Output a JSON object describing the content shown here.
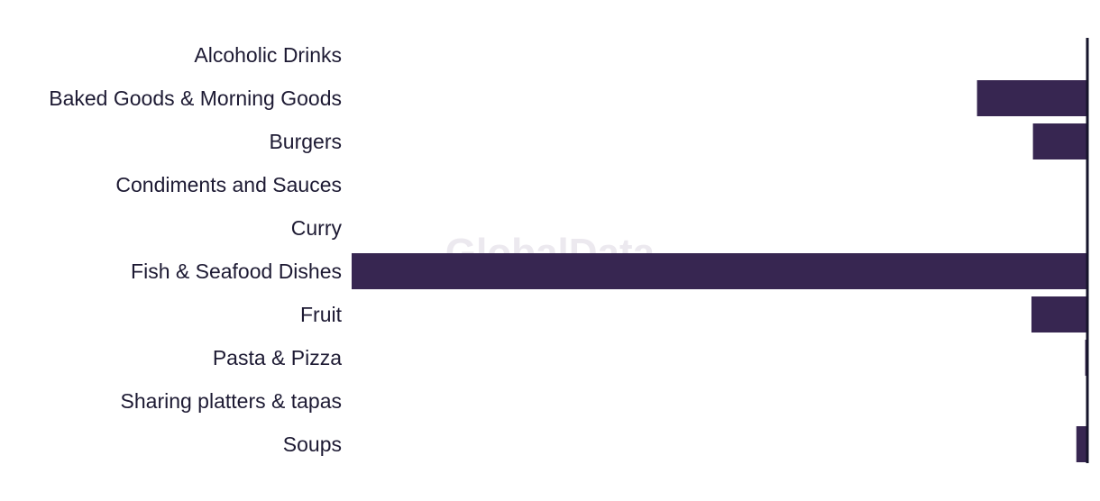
{
  "chart_data": {
    "type": "bar",
    "orientation": "horizontal",
    "title": "",
    "xlabel": "",
    "ylabel": "",
    "categories": [
      "Alcoholic Drinks",
      "Baked Goods & Morning Goods",
      "Burgers",
      "Condiments and Sauces",
      "Curry",
      "Fish & Seafood Dishes",
      "Fruit",
      "Pasta & Pizza",
      "Sharing platters & tapas",
      "Soups"
    ],
    "values": [
      0,
      -15,
      -7.4,
      0,
      0,
      -100,
      -7.6,
      -0.3,
      0,
      -1.5
    ],
    "xlim": [
      -100,
      0
    ],
    "grid": false,
    "bar_color": "#372651",
    "axis_color": "#16142b",
    "watermark": "GlobalData"
  }
}
